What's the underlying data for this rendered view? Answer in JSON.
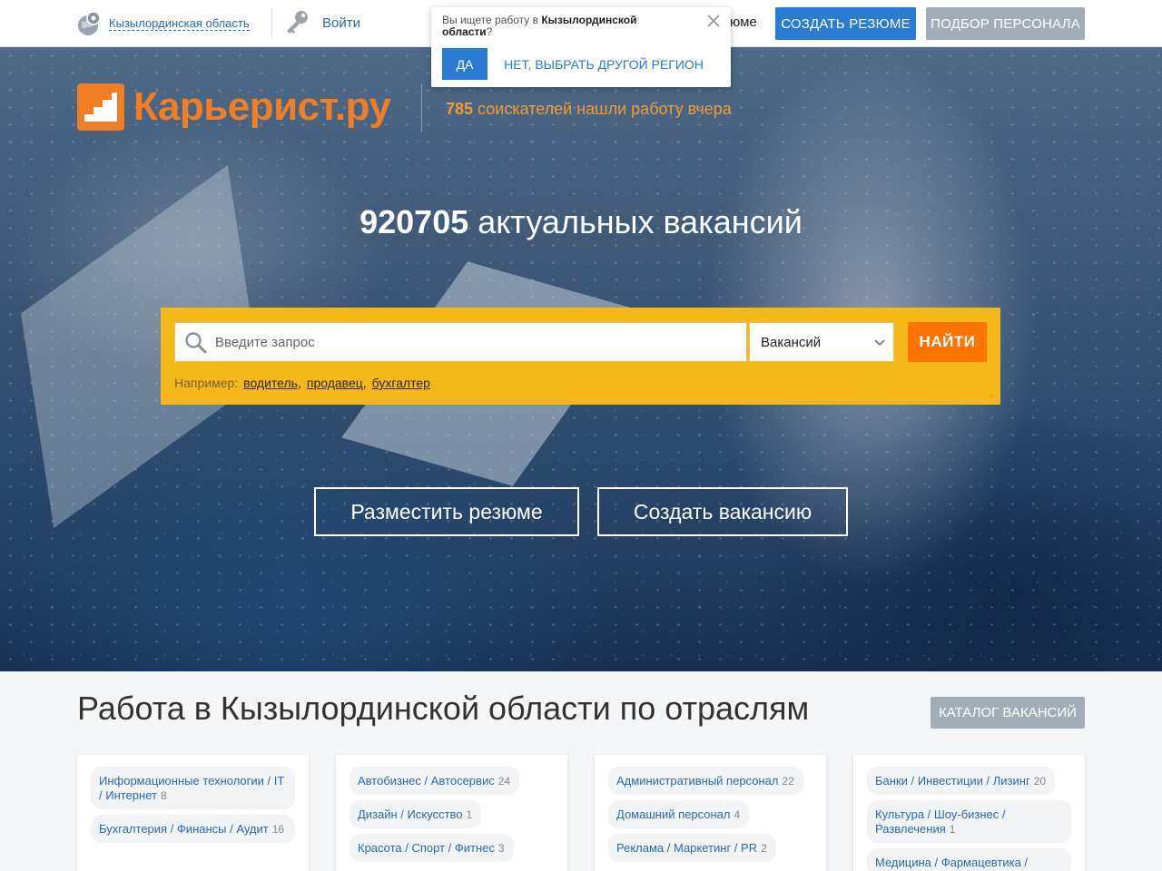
{
  "topbar": {
    "region_label": "Кызылординская область",
    "login_label": "Войти",
    "resume_link": "юме",
    "create_resume": "СОЗДАТЬ РЕЗЮМЕ",
    "staff_selection": "ПОДБОР ПЕРСОНАЛА"
  },
  "popup": {
    "question_prefix": "Вы ищете работу в ",
    "region": "Кызылординской области",
    "question_suffix": "?",
    "yes": "ДА",
    "other": "НЕТ, ВЫБРАТЬ ДРУГОЙ РЕГИОН"
  },
  "hero": {
    "logo_text": "Карьерист.ру",
    "tagline_count": "785",
    "tagline_text": " соискателей нашли работу вчера",
    "vacancy_count": "920705",
    "vacancy_text": " актуальных вакансий",
    "search_placeholder": "Введите запрос",
    "search_type": "Вакансий",
    "find": "НАЙТИ",
    "examples_label": "Например:",
    "examples": [
      "водитель",
      "продавец",
      "бухгалтер"
    ],
    "post_resume": "Разместить резюме",
    "create_vacancy": "Создать вакансию"
  },
  "section": {
    "title": "Работа в Кызылординской области по отраслям",
    "catalog": "КАТАЛОГ ВАКАНСИЙ"
  },
  "columns": [
    [
      {
        "name": "Информационные технологии / IT / Интернет",
        "count": "8"
      },
      {
        "name": "Бухгалтерия / Финансы / Аудит",
        "count": "16"
      }
    ],
    [
      {
        "name": "Автобизнес / Автосервис",
        "count": "24"
      },
      {
        "name": "Дизайн / Искусство",
        "count": "1"
      },
      {
        "name": "Красота / Спорт / Фитнес",
        "count": "3"
      }
    ],
    [
      {
        "name": "Административный персонал",
        "count": "22"
      },
      {
        "name": "Домашний персонал",
        "count": "4"
      },
      {
        "name": "Реклама / Маркетинг / PR",
        "count": "2"
      }
    ],
    [
      {
        "name": "Банки / Инвестиции / Лизинг",
        "count": "20"
      },
      {
        "name": "Культура / Шоу-бизнес / Развлечения",
        "count": "1"
      },
      {
        "name": "Медицина / Фармацевтика /",
        "count": ""
      }
    ]
  ],
  "colors": {
    "brand_orange": "#f07e25",
    "accent_blue": "#2a7bd4",
    "search_yellow": "#f4b919",
    "find_orange": "#ff7300",
    "muted_gray": "#a3adb8"
  }
}
